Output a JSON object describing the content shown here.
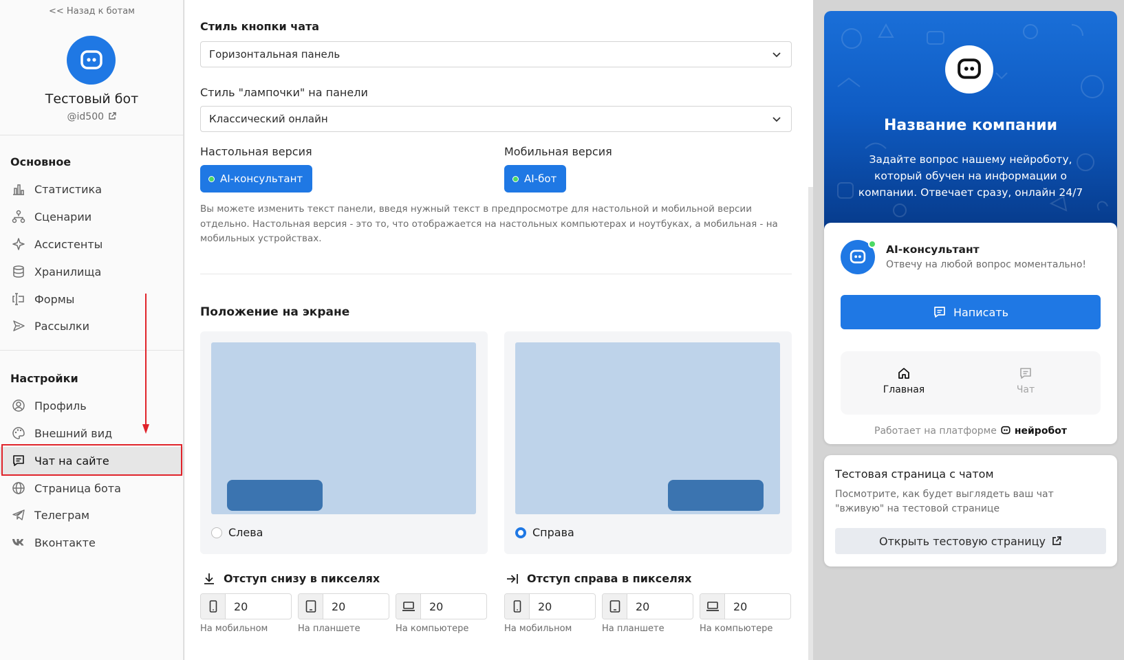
{
  "sidebar": {
    "back_link": "<< Назад к ботам",
    "bot_name": "Тестовый бот",
    "bot_handle": "@id500",
    "sections": {
      "main_title": "Основное",
      "settings_title": "Настройки"
    },
    "main_items": [
      {
        "label": "Статистика",
        "icon": "bar-chart-icon"
      },
      {
        "label": "Сценарии",
        "icon": "flow-icon"
      },
      {
        "label": "Ассистенты",
        "icon": "sparkle-icon"
      },
      {
        "label": "Хранилища",
        "icon": "database-icon"
      },
      {
        "label": "Формы",
        "icon": "form-icon"
      },
      {
        "label": "Рассылки",
        "icon": "send-icon"
      }
    ],
    "settings_items": [
      {
        "label": "Профиль",
        "icon": "user-circle-icon"
      },
      {
        "label": "Внешний вид",
        "icon": "palette-icon"
      },
      {
        "label": "Чат на сайте",
        "icon": "chat-icon",
        "active": true
      },
      {
        "label": "Страница бота",
        "icon": "globe-icon"
      },
      {
        "label": "Телеграм",
        "icon": "telegram-icon"
      },
      {
        "label": "Вконтакте",
        "icon": "vk-icon"
      }
    ]
  },
  "main": {
    "chat_button_style_label": "Стиль кнопки чата",
    "chat_button_style_value": "Горизонтальная панель",
    "bulb_style_label": "Стиль \"лампочки\" на панели",
    "bulb_style_value": "Классический онлайн",
    "desktop_label": "Настольная версия",
    "desktop_pill": "AI-консультант",
    "mobile_label": "Мобильная версия",
    "mobile_pill": "AI-бот",
    "help_text": "Вы можете изменить текст панели, введя нужный текст в предпросмотре для настольной и мобильной версии отдельно. Настольная версия - это то, что отображается на настольных компьютерах и ноутбуках, а мобильная - на мобильных устройствах.",
    "position_title": "Положение на экране",
    "position_options": {
      "left": "Слева",
      "right": "Справа",
      "selected": "right"
    },
    "offset_bottom_title": "Отступ снизу в пикселях",
    "offset_right_title": "Отступ справа в пикселях",
    "offset_bottom": {
      "mobile": "20",
      "tablet": "20",
      "desktop": "20"
    },
    "offset_right": {
      "mobile": "20",
      "tablet": "20",
      "desktop": "20"
    },
    "captions": {
      "mobile": "На мобильном",
      "tablet": "На планшете",
      "desktop": "На компьютере"
    }
  },
  "preview": {
    "company_name": "Название компании",
    "description": "Задайте вопрос нашему нейроботу, который обучен на информации о компании. Отвечает сразу, онлайн 24/7",
    "agent_name": "AI-консультант",
    "agent_subtitle": "Отвечу на любой вопрос моментально!",
    "write_button": "Написать",
    "tab_home": "Главная",
    "tab_chat": "Чат",
    "powered_by": "Работает на платформе",
    "brand": "нейробот"
  },
  "test_page": {
    "title": "Тестовая страница с чатом",
    "description": "Посмотрите, как будет выглядеть ваш чат \"вживую\" на тестовой странице",
    "button": "Открыть тестовую страницу"
  },
  "colors": {
    "accent": "#1f78e4",
    "highlight": "#e0232a",
    "online": "#4cd964"
  }
}
